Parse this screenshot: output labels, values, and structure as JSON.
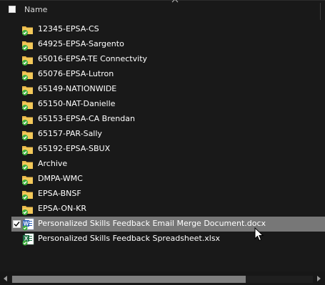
{
  "header": {
    "name_label": "Name",
    "sort_icon": "chevron-up-icon"
  },
  "items": [
    {
      "label": "12345-EPSA-CS",
      "type": "folder",
      "icon": "synced-folder-icon"
    },
    {
      "label": "64925-EPSA-Sargento",
      "type": "folder",
      "icon": "synced-folder-icon"
    },
    {
      "label": "65016-EPSA-TE Connectvity",
      "type": "folder",
      "icon": "synced-folder-icon"
    },
    {
      "label": "65076-EPSA-Lutron",
      "type": "folder",
      "icon": "synced-folder-icon"
    },
    {
      "label": "65149-NATIONWIDE",
      "type": "folder",
      "icon": "synced-folder-icon"
    },
    {
      "label": "65150-NAT-Danielle",
      "type": "folder",
      "icon": "synced-folder-icon"
    },
    {
      "label": "65153-EPSA-CA Brendan",
      "type": "folder",
      "icon": "synced-folder-icon"
    },
    {
      "label": "65157-PAR-Sally",
      "type": "folder",
      "icon": "synced-folder-icon"
    },
    {
      "label": "65192-EPSA-SBUX",
      "type": "folder",
      "icon": "synced-folder-icon"
    },
    {
      "label": "Archive",
      "type": "folder",
      "icon": "synced-folder-icon"
    },
    {
      "label": "DMPA-WMC",
      "type": "folder",
      "icon": "synced-folder-icon"
    },
    {
      "label": "EPSA-BNSF",
      "type": "folder",
      "icon": "synced-folder-icon"
    },
    {
      "label": "EPSA-ON-KR",
      "type": "folder",
      "icon": "synced-folder-icon"
    },
    {
      "label": "Personalized Skills Feedback Email Merge Document.docx",
      "type": "word",
      "icon": "word-document-icon",
      "selected": true,
      "checked": true
    },
    {
      "label": "Personalized Skills Feedback Spreadsheet.xlsx",
      "type": "excel",
      "icon": "excel-document-icon"
    }
  ],
  "colors": {
    "background": "#191919",
    "selection": "#777777",
    "folder": "#e8b84a",
    "sync_badge": "#3cae3c",
    "word": "#2b5fb8",
    "excel": "#1d7044"
  }
}
